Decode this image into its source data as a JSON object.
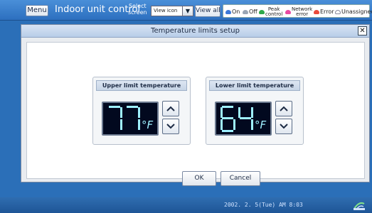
{
  "topbar": {
    "menu_label": "Menu",
    "title": "Indoor unit control",
    "select_screen_line1": "Select",
    "select_screen_line2": "screen",
    "select_value": "View icon",
    "view_all_label": "View all"
  },
  "legend": {
    "on": "On",
    "off": "Off",
    "peak_line1": "Peak",
    "peak_line2": "control",
    "network_line1": "Network",
    "network_line2": "error",
    "error": "Error",
    "unassigned": "Unassigned",
    "colors": {
      "on": "#3c78d8",
      "off": "#9aa6b5",
      "peak": "#2ea84a",
      "network": "#e94aa2",
      "error": "#e84a3c",
      "unassigned": "#c8c8c8"
    }
  },
  "dialog": {
    "title": "Temperature limits setup",
    "close_icon": "close-icon",
    "upper": {
      "label": "Upper limit temperature",
      "value": "77",
      "unit": "°F"
    },
    "lower": {
      "label": "Lower limit temperature",
      "value": "64",
      "unit": "°F"
    },
    "ok_label": "OK",
    "cancel_label": "Cancel"
  },
  "statusbar": {
    "datetime": "2002. 2. 5(Tue) AM 8:03",
    "icon": "network-status-icon"
  },
  "colors": {
    "lcd_digit": "#9ff0ff",
    "lcd_bg": "#02091f",
    "accent": "#2b6fb8"
  }
}
